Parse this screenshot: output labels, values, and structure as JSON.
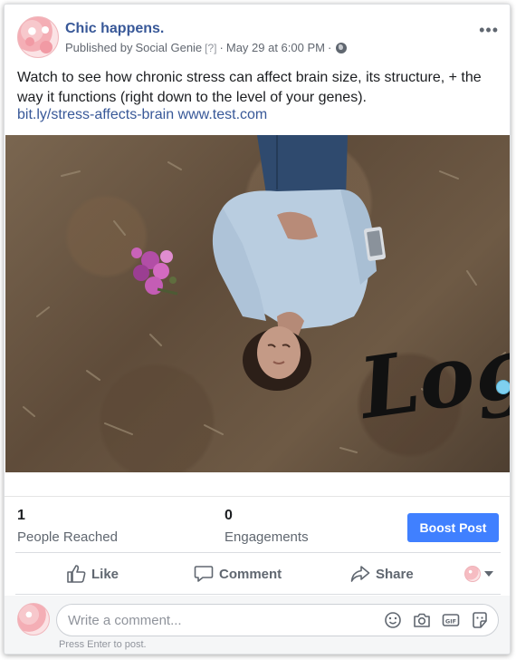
{
  "post": {
    "page_name": "Chic happens.",
    "published_by_prefix": "Published by",
    "publisher": "Social Genie",
    "publisher_tag": "[?]",
    "date_separator": "·",
    "date": "May 29 at 6:00 PM",
    "audience_separator": "·",
    "audience_icon": "globe-icon",
    "more_icon": "more-horizontal-icon",
    "more_label": "•••",
    "text": "Watch to see how chronic stress can affect brain size, its structure, + the way it functions (right down to the level of your genes).",
    "link_1": "bit.ly/stress-affects-brain",
    "link_2": "www.test.com",
    "image_overlay_text": "Logo"
  },
  "stats": {
    "reached_value": "1",
    "reached_label": "People Reached",
    "engagements_value": "0",
    "engagements_label": "Engagements",
    "boost_label": "Boost Post"
  },
  "actions": {
    "like_label": "Like",
    "comment_label": "Comment",
    "share_label": "Share"
  },
  "comment": {
    "placeholder": "Write a comment...",
    "hint": "Press Enter to post.",
    "icons": [
      "emoji-icon",
      "camera-icon",
      "gif-icon",
      "sticker-icon"
    ]
  },
  "colors": {
    "link": "#385898",
    "boost": "#4080ff",
    "secondary_text": "#606770"
  }
}
